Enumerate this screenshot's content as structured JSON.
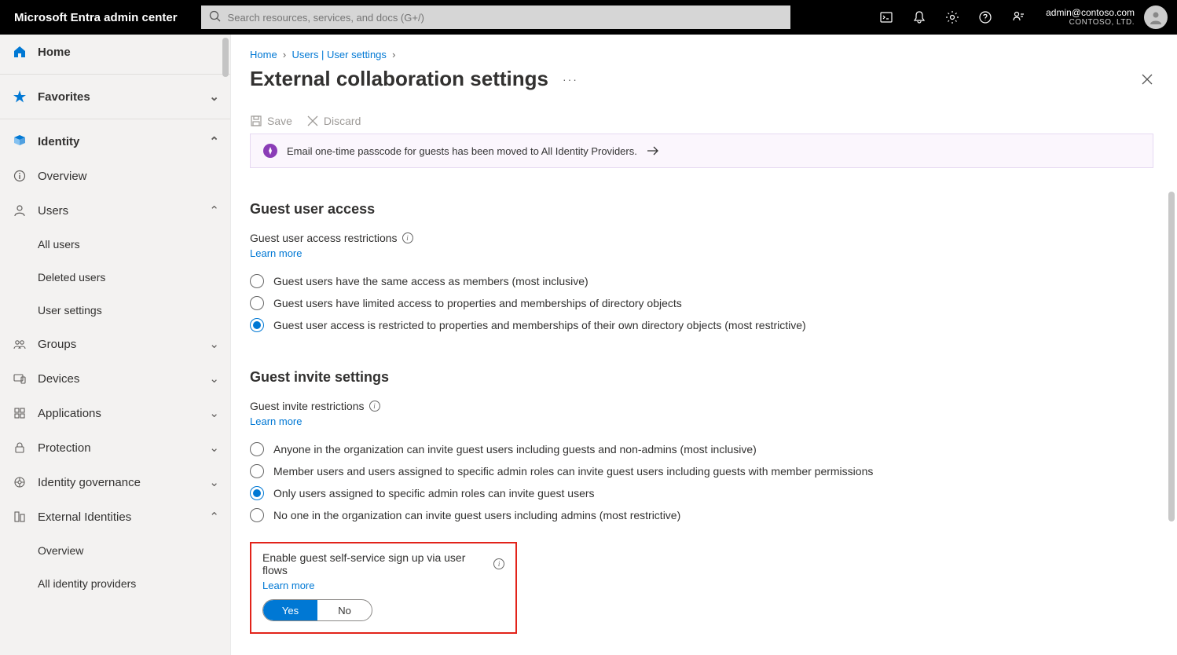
{
  "brand": "Microsoft Entra admin center",
  "search": {
    "placeholder": "Search resources, services, and docs (G+/)"
  },
  "account": {
    "email": "admin@contoso.com",
    "org": "CONTOSO, LTD."
  },
  "sidebar": {
    "home": "Home",
    "favorites": "Favorites",
    "identity": "Identity",
    "overview": "Overview",
    "users": "Users",
    "users_all": "All users",
    "users_deleted": "Deleted users",
    "users_settings": "User settings",
    "groups": "Groups",
    "devices": "Devices",
    "applications": "Applications",
    "protection": "Protection",
    "identity_gov": "Identity governance",
    "external": "External Identities",
    "external_overview": "Overview",
    "external_idp": "All identity providers"
  },
  "breadcrumb": {
    "home": "Home",
    "users": "Users | User settings",
    "chev": "›"
  },
  "page": {
    "title": "External collaboration settings",
    "more": "···"
  },
  "commands": {
    "save": "Save",
    "discard": "Discard"
  },
  "banner": {
    "text": "Email one-time passcode for guests has been moved to All Identity Providers."
  },
  "guest_access": {
    "heading": "Guest user access",
    "sub": "Guest user access restrictions",
    "learn": "Learn more",
    "options": [
      "Guest users have the same access as members (most inclusive)",
      "Guest users have limited access to properties and memberships of directory objects",
      "Guest user access is restricted to properties and memberships of their own directory objects (most restrictive)"
    ],
    "selected": 2
  },
  "guest_invite": {
    "heading": "Guest invite settings",
    "sub": "Guest invite restrictions",
    "learn": "Learn more",
    "options": [
      "Anyone in the organization can invite guest users including guests and non-admins (most inclusive)",
      "Member users and users assigned to specific admin roles can invite guest users including guests with member permissions",
      "Only users assigned to specific admin roles can invite guest users",
      "No one in the organization can invite guest users including admins (most restrictive)"
    ],
    "selected": 2
  },
  "self_service": {
    "label": "Enable guest self-service sign up via user flows",
    "learn": "Learn more",
    "yes": "Yes",
    "no": "No",
    "value": true
  }
}
